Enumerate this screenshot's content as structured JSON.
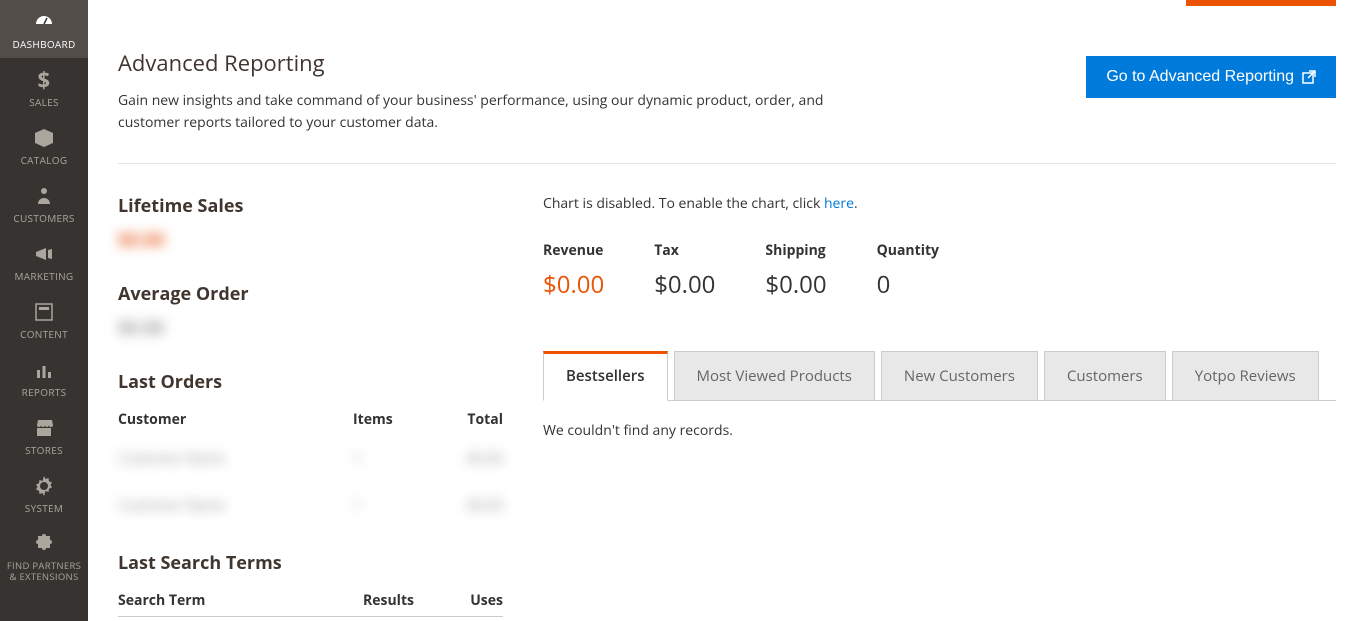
{
  "sidebar": {
    "items": [
      {
        "label": "DASHBOARD",
        "icon": "dashboard"
      },
      {
        "label": "SALES",
        "icon": "dollar"
      },
      {
        "label": "CATALOG",
        "icon": "box"
      },
      {
        "label": "CUSTOMERS",
        "icon": "person"
      },
      {
        "label": "MARKETING",
        "icon": "megaphone"
      },
      {
        "label": "CONTENT",
        "icon": "content"
      },
      {
        "label": "REPORTS",
        "icon": "bars"
      },
      {
        "label": "STORES",
        "icon": "storefront"
      },
      {
        "label": "SYSTEM",
        "icon": "gear"
      },
      {
        "label": "FIND PARTNERS & EXTENSIONS",
        "icon": "puzzle"
      }
    ]
  },
  "adv": {
    "title": "Advanced Reporting",
    "desc": "Gain new insights and take command of your business' performance, using our dynamic product, order, and customer reports tailored to your customer data.",
    "button": "Go to Advanced Reporting"
  },
  "stats": {
    "lifetime_title": "Lifetime Sales",
    "lifetime_value": "$0.00",
    "avg_title": "Average Order",
    "avg_value": "$0.00"
  },
  "last_orders": {
    "title": "Last Orders",
    "cols": {
      "customer": "Customer",
      "items": "Items",
      "total": "Total"
    },
    "rows": [
      {
        "customer": "Customer Name",
        "items": "1",
        "total": "$0.00"
      },
      {
        "customer": "Customer Name",
        "items": "1",
        "total": "$0.00"
      }
    ]
  },
  "last_search": {
    "title": "Last Search Terms",
    "cols": {
      "term": "Search Term",
      "results": "Results",
      "uses": "Uses"
    }
  },
  "chart": {
    "note_prefix": "Chart is disabled. To enable the chart, click ",
    "link": "here",
    "note_suffix": "."
  },
  "metrics": [
    {
      "label": "Revenue",
      "value": "$0.00",
      "orange": true
    },
    {
      "label": "Tax",
      "value": "$0.00",
      "orange": false
    },
    {
      "label": "Shipping",
      "value": "$0.00",
      "orange": false
    },
    {
      "label": "Quantity",
      "value": "0",
      "orange": false
    }
  ],
  "tabs": [
    "Bestsellers",
    "Most Viewed Products",
    "New Customers",
    "Customers",
    "Yotpo Reviews"
  ],
  "tab_content": "We couldn't find any records."
}
